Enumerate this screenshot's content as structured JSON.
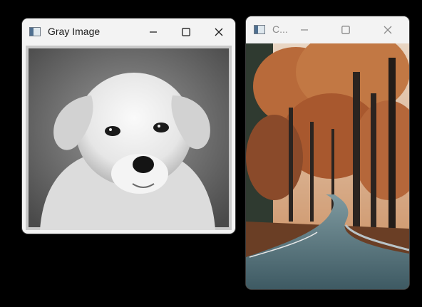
{
  "windows": [
    {
      "title": "Gray Image",
      "image": "grayscale-puppy-photo",
      "icon": "app-window-icon"
    },
    {
      "title": "C...",
      "image": "autumn-forest-road-photo",
      "icon": "app-window-icon"
    }
  ],
  "controls": {
    "minimize": "minimize-icon",
    "maximize": "maximize-icon",
    "close": "close-icon"
  },
  "colors": {
    "desktop": "#000000",
    "titlebar": "#f3f3f3"
  }
}
